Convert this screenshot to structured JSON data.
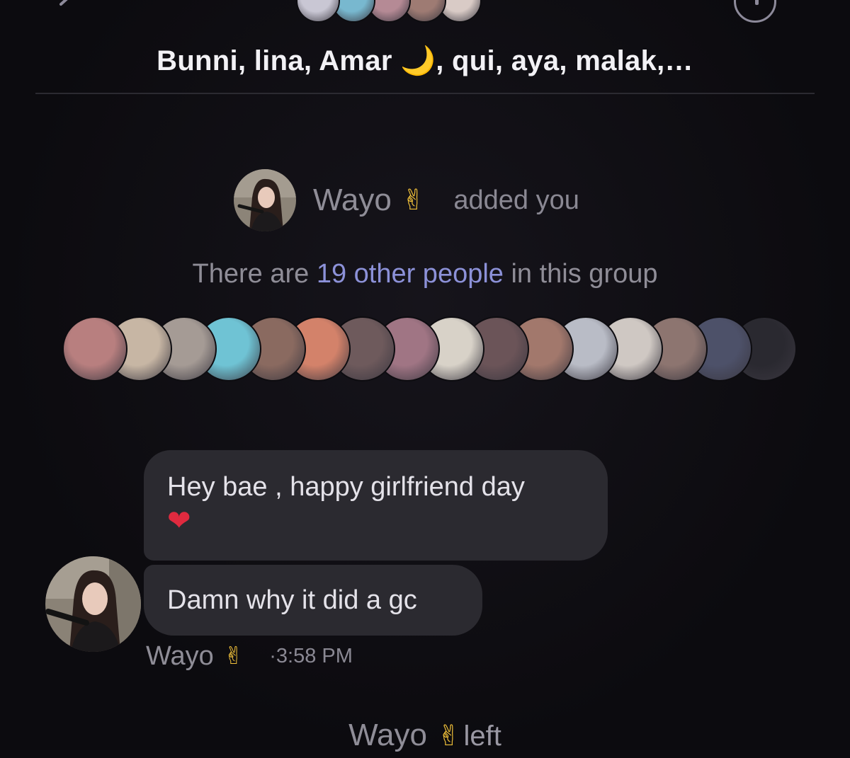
{
  "header": {
    "title": "Bunni, lina, Amar 🌙, qui, aya, malak,…",
    "avatar_colors": [
      "#c9c7d4",
      "#78b8cf",
      "#b58a95",
      "#9e7b73",
      "#d9cbc6"
    ]
  },
  "added": {
    "name": "Wayo",
    "emoji": "✌",
    "text": "added you"
  },
  "group_info": {
    "prefix": "There are ",
    "highlight": "19 other people",
    "suffix": " in this group"
  },
  "members": {
    "avatar_colors": [
      "#b87f7f",
      "#c7b6a4",
      "#a59b95",
      "#6fc3d4",
      "#8a6a60",
      "#d3826a",
      "#6e5a5c",
      "#a07584",
      "#d8d2c8",
      "#6b5458",
      "#a2786c",
      "#b9bcc6",
      "#cfc8c3",
      "#8d7570",
      "#4d5169",
      "#2a2930"
    ]
  },
  "messages": [
    {
      "text": "Hey bae , happy girlfriend day",
      "emoji": "❤"
    },
    {
      "text": "Damn why it did a gc"
    }
  ],
  "meta": {
    "name": "Wayo",
    "emoji": "✌",
    "time": "·3:58 PM"
  },
  "left_event": {
    "name": "Wayo",
    "emoji": "✌",
    "text": "left"
  },
  "colors": {
    "background": "#0d0c10",
    "bubble": "#2b2a30",
    "link": "#8c91d8",
    "muted_text": "#8f8d97",
    "heart": "#e02a3f"
  }
}
